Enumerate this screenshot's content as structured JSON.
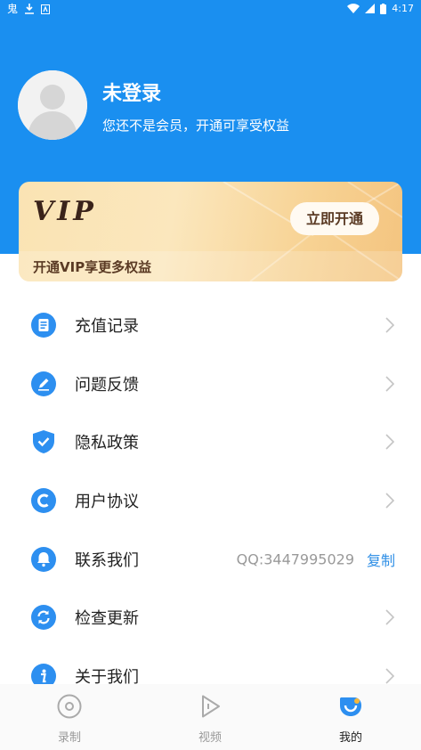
{
  "status_bar": {
    "left_icons": [
      "app-icon",
      "download-icon",
      "notification-icon"
    ],
    "time": "4:17",
    "app_glyph": "鬼"
  },
  "profile": {
    "name": "未登录",
    "subtitle": "您还不是会员，开通可享受权益"
  },
  "vip_card": {
    "logo": "VIP",
    "button_label": "立即开通",
    "subtitle": "开通VIP享更多权益"
  },
  "menu": {
    "items": [
      {
        "label": "充值记录",
        "icon": "document-list-icon"
      },
      {
        "label": "问题反馈",
        "icon": "edit-pen-icon"
      },
      {
        "label": "隐私政策",
        "icon": "shield-check-icon"
      },
      {
        "label": "用户协议",
        "icon": "agreement-c-icon"
      },
      {
        "label": "联系我们",
        "icon": "bell-contact-icon",
        "value": "QQ:3447995029",
        "action": "复制"
      },
      {
        "label": "检查更新",
        "icon": "refresh-icon"
      },
      {
        "label": "关于我们",
        "icon": "info-icon"
      }
    ]
  },
  "tabbar": {
    "tabs": [
      {
        "label": "录制",
        "icon": "record-disc-icon"
      },
      {
        "label": "视频",
        "icon": "video-play-icon"
      },
      {
        "label": "我的",
        "icon": "profile-icon",
        "active": true
      }
    ]
  },
  "colors": {
    "header_blue": "#1a8ff0",
    "accent_blue": "#2f8fe6",
    "vip_gold": "#f7d293",
    "vip_text_brown": "#5a3a24"
  }
}
